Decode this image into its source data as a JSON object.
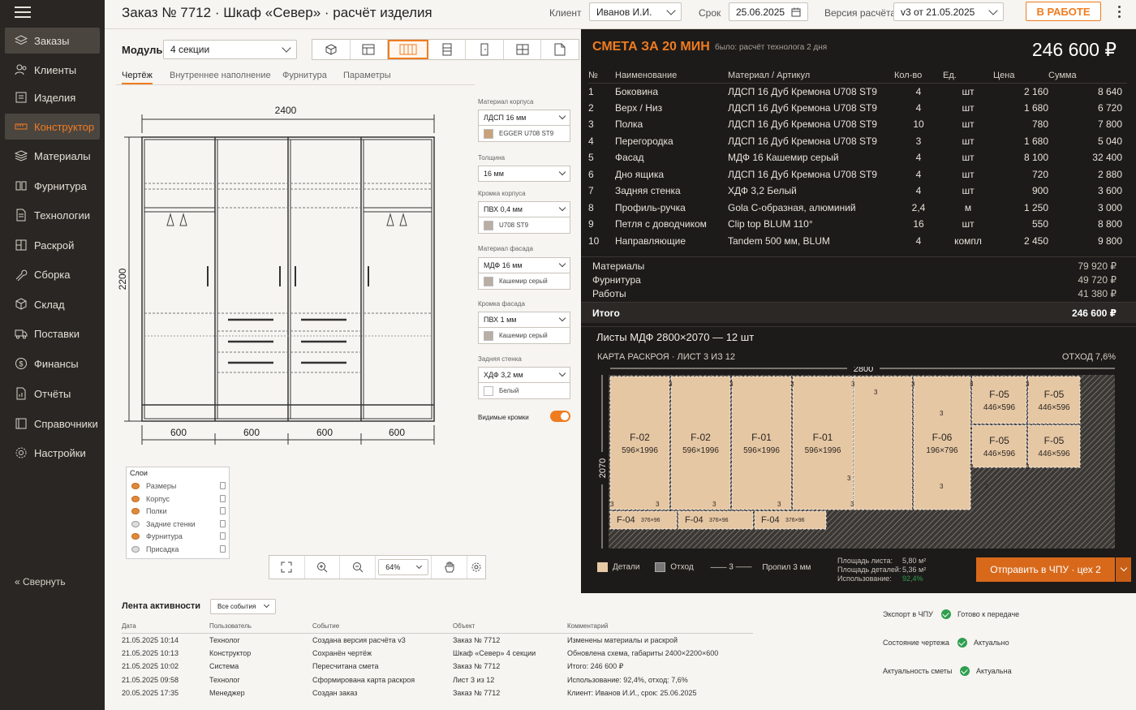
{
  "app": {
    "title": "Заказ № 7712 · Шкаф «Север» · расчёт изделия"
  },
  "header": {
    "client_label": "Клиент",
    "client_value": "Иванов И.И.",
    "deadline_label": "Срок",
    "deadline_value": "25.06.2025",
    "version_label": "Версия расчёта",
    "version_value": "v3 от 21.05.2025",
    "status": "В РАБОТЕ"
  },
  "sidebar": {
    "items": [
      {
        "label": "Заказы",
        "icon": "layers-icon"
      },
      {
        "label": "Клиенты",
        "icon": "users-icon"
      },
      {
        "label": "Изделия",
        "icon": "box-icon"
      },
      {
        "label": "Конструктор",
        "icon": "ruler-icon"
      },
      {
        "label": "Материалы",
        "icon": "stack-icon"
      },
      {
        "label": "Фурнитура",
        "icon": "hinge-icon"
      },
      {
        "label": "Технологии",
        "icon": "document-icon"
      },
      {
        "label": "Раскрой",
        "icon": "cut-icon"
      },
      {
        "label": "Сборка",
        "icon": "wrench-icon"
      },
      {
        "label": "Склад",
        "icon": "cube-icon"
      },
      {
        "label": "Поставки",
        "icon": "truck-icon"
      },
      {
        "label": "Финансы",
        "icon": "dollar-icon"
      },
      {
        "label": "Отчёты",
        "icon": "report-icon"
      },
      {
        "label": "Справочники",
        "icon": "book-icon"
      },
      {
        "label": "Настройки",
        "icon": "gear-icon"
      }
    ],
    "collapse_label": "Свернуть"
  },
  "editor": {
    "module_label": "Модуль",
    "module_value": "4 секции",
    "tabs": [
      "Чертёж",
      "Внутреннее наполнение",
      "Фурнитура",
      "Параметры"
    ],
    "view_icons": [
      "cube-view-icon",
      "front-view-icon",
      "sections-view-icon",
      "side-view-icon",
      "door-view-icon",
      "grid-view-icon",
      "sheet-view-icon"
    ],
    "drawing": {
      "width_label": "2400",
      "height_label": "2200",
      "sections": [
        "600",
        "600",
        "600",
        "600"
      ]
    },
    "props": {
      "body_material_label": "Материал корпуса",
      "body_material_value": "ЛДСП 16 мм",
      "body_decor": "EGGER U708 ST9",
      "thickness_label": "Толщина",
      "thickness_value": "16 мм",
      "body_edge_label": "Кромка корпуса",
      "body_edge_value": "ПВХ 0,4 мм",
      "body_edge_decor": "U708 ST9",
      "facade_material_label": "Материал фасада",
      "facade_material_value": "МДФ 16 мм",
      "facade_decor": "Кашемир серый",
      "facade_edge_label": "Кромка фасада",
      "facade_edge_value": "ПВХ 1 мм",
      "facade_edge_decor": "Кашемир серый",
      "back_label": "Задняя стенка",
      "back_value": "ХДФ 3,2 мм",
      "back_decor": "Белый",
      "visible_edges_label": "Видимые кромки",
      "visible_edges_on": true,
      "colors": {
        "oak": "#c9a27a",
        "grey": "#b8aea4",
        "white": "#ffffff"
      }
    },
    "layers": {
      "title": "Слои",
      "items": [
        {
          "label": "Размеры",
          "visible": true
        },
        {
          "label": "Корпус",
          "visible": true
        },
        {
          "label": "Полки",
          "visible": true
        },
        {
          "label": "Задние стенки",
          "visible": false
        },
        {
          "label": "Фурнитура",
          "visible": true
        },
        {
          "label": "Присадка",
          "visible": false
        }
      ]
    },
    "zoom": "64%"
  },
  "estimate": {
    "title": "СМЕТА ЗА 20 МИН",
    "note": "было: расчёт технолога 2 дня",
    "total": "246 600 ₽",
    "columns": [
      "№",
      "Наименование",
      "Материал / Артикул",
      "Кол-во",
      "Ед.",
      "Цена",
      "Сумма"
    ],
    "rows": [
      [
        "1",
        "Боковина",
        "ЛДСП 16 Дуб Кремона U708 ST9",
        "4",
        "шт",
        "2 160",
        "8 640"
      ],
      [
        "2",
        "Верх / Низ",
        "ЛДСП 16 Дуб Кремона U708 ST9",
        "4",
        "шт",
        "1 680",
        "6 720"
      ],
      [
        "3",
        "Полка",
        "ЛДСП 16 Дуб Кремона U708 ST9",
        "10",
        "шт",
        "780",
        "7 800"
      ],
      [
        "4",
        "Перегородка",
        "ЛДСП 16 Дуб Кремона U708 ST9",
        "3",
        "шт",
        "1 680",
        "5 040"
      ],
      [
        "5",
        "Фасад",
        "МДФ 16 Кашемир серый",
        "4",
        "шт",
        "8 100",
        "32 400"
      ],
      [
        "6",
        "Дно ящика",
        "ЛДСП 16 Дуб Кремона U708 ST9",
        "4",
        "шт",
        "720",
        "2 880"
      ],
      [
        "7",
        "Задняя стенка",
        "ХДФ 3,2 Белый",
        "4",
        "шт",
        "900",
        "3 600"
      ],
      [
        "8",
        "Профиль-ручка",
        "Gola C-образная, алюминий",
        "2,4",
        "м",
        "1 250",
        "3 000"
      ],
      [
        "9",
        "Петля с доводчиком",
        "Clip top BLUM 110°",
        "16",
        "шт",
        "550",
        "8 800"
      ],
      [
        "10",
        "Направляющие",
        "Tandem 500 мм, BLUM",
        "4",
        "компл",
        "2 450",
        "9 800"
      ]
    ],
    "summary": [
      {
        "label": "Материалы",
        "value": "79 920 ₽"
      },
      {
        "label": "Фурнитура",
        "value": "49 720 ₽"
      },
      {
        "label": "Работы",
        "value": "41 380 ₽"
      }
    ],
    "total_label": "Итого",
    "total_value": "246 600 ₽",
    "sheets_title": "Листы МДФ 2800×2070 — 12 шт",
    "map_title": "КАРТА РАСКРОЯ · ЛИСТ 3 ИЗ 12",
    "waste": "ОТХОД 7,6%",
    "map": {
      "sheet_w": "2800",
      "sheet_h": "2070",
      "cut": "3",
      "parts": [
        {
          "id": "F-02",
          "size": "596×1996"
        },
        {
          "id": "F-02",
          "size": "596×1996"
        },
        {
          "id": "F-01",
          "size": "596×1996"
        },
        {
          "id": "F-01",
          "size": "596×1996"
        },
        {
          "id": "F-06",
          "size": "196×796"
        },
        {
          "id": "F-05",
          "size": "446×596"
        },
        {
          "id": "F-05",
          "size": "446×596"
        },
        {
          "id": "F-05",
          "size": "446×596"
        },
        {
          "id": "F-05",
          "size": "446×596"
        },
        {
          "id": "F-04",
          "size": "376×96"
        },
        {
          "id": "F-04",
          "size": "376×96"
        },
        {
          "id": "F-04",
          "size": "376×96"
        }
      ]
    },
    "legend": {
      "details": "Детали",
      "waste": "Отход",
      "cut_value": "3",
      "cut_label": "Пропил 3 мм"
    },
    "stats": {
      "sheet_area_label": "Площадь листа:",
      "sheet_area": "5,80 м²",
      "parts_area_label": "Площадь деталей:",
      "parts_area": "5,36 м²",
      "usage_label": "Использование:",
      "usage": "92,4%"
    },
    "send_label": "Отправить в ЧПУ · цех 2"
  },
  "feed": {
    "title": "Лента активности",
    "filter": "Все события",
    "columns": [
      "Дата",
      "Пользователь",
      "Событие",
      "Объект",
      "Комментарий"
    ],
    "rows": [
      [
        "21.05.2025  10:14",
        "Технолог",
        "Создана версия расчёта  v3",
        "Заказ № 7712",
        "Изменены материалы и раскрой"
      ],
      [
        "21.05.2025  10:13",
        "Конструктор",
        "Сохранён чертёж",
        "Шкаф «Север» 4 секции",
        "Обновлена схема, габариты  2400×2200×600"
      ],
      [
        "21.05.2025  10:02",
        "Система",
        "Пересчитана смета",
        "Заказ № 7712",
        "Итого: 246 600 ₽"
      ],
      [
        "21.05.2025  09:58",
        "Технолог",
        "Сформирована карта раскроя",
        "Лист 3 из 12",
        "Использование: 92,4%, отход: 7,6%"
      ],
      [
        "20.05.2025  17:35",
        "Менеджер",
        "Создан заказ",
        "Заказ № 7712",
        "Клиент: Иванов И.И., срок: 25.06.2025"
      ]
    ],
    "checks": [
      {
        "label": "Экспорт в ЧПУ",
        "status": "Готово к передаче"
      },
      {
        "label": "Состояние чертежа",
        "status": "Актуально"
      },
      {
        "label": "Актуальность сметы",
        "status": "Актуальна"
      }
    ]
  },
  "colors": {
    "accent": "#f07c20",
    "sidebar": "#2a2623",
    "dark_panel": "#1d1b19",
    "ok": "#2e9e4f",
    "usage": "#2e9e4f"
  }
}
